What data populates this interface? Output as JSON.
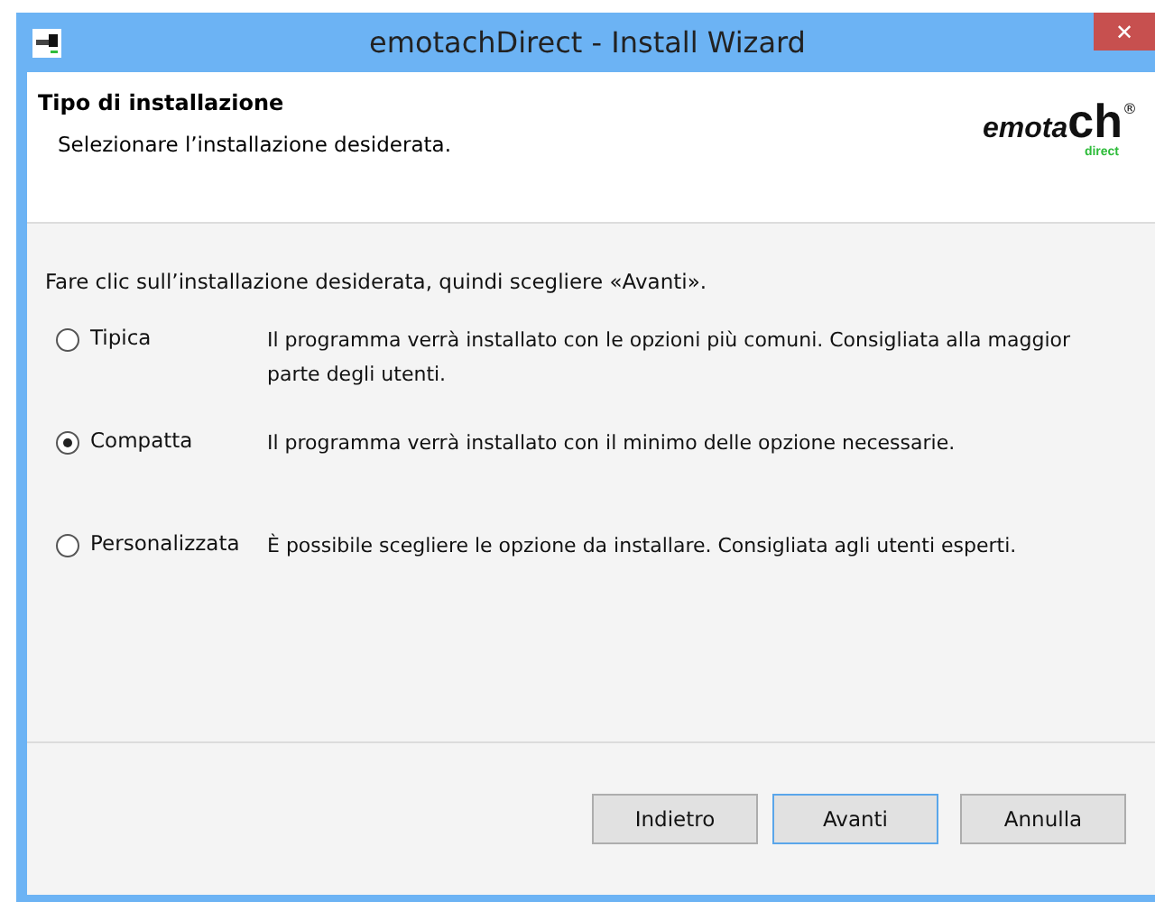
{
  "window": {
    "title": "emotachDirect - Install Wizard",
    "close": "✕"
  },
  "header": {
    "title": "Tipo di installazione",
    "subtitle": "Selezionare l’installazione desiderata.",
    "logo": {
      "main": "emota",
      "accent": "ch",
      "mark": "®",
      "sub": "direct"
    }
  },
  "instruction": "Fare clic sull’installazione desiderata, quindi scegliere «Avanti».",
  "options": [
    {
      "label": "Tipica",
      "description": "Il programma verrà installato con le opzioni più comuni. Consigliata alla maggior parte degli utenti.",
      "selected": false
    },
    {
      "label": "Compatta",
      "description": "Il programma verrà installato con il minimo delle opzione necessarie.",
      "selected": true
    },
    {
      "label": "Personalizzata",
      "description": "È possibile scegliere le opzione da installare. Consigliata agli utenti esperti.",
      "selected": false
    }
  ],
  "buttons": [
    {
      "label": "Indietro",
      "focused": false
    },
    {
      "label": "Avanti",
      "focused": true
    },
    {
      "label": "Annulla",
      "focused": false
    }
  ]
}
